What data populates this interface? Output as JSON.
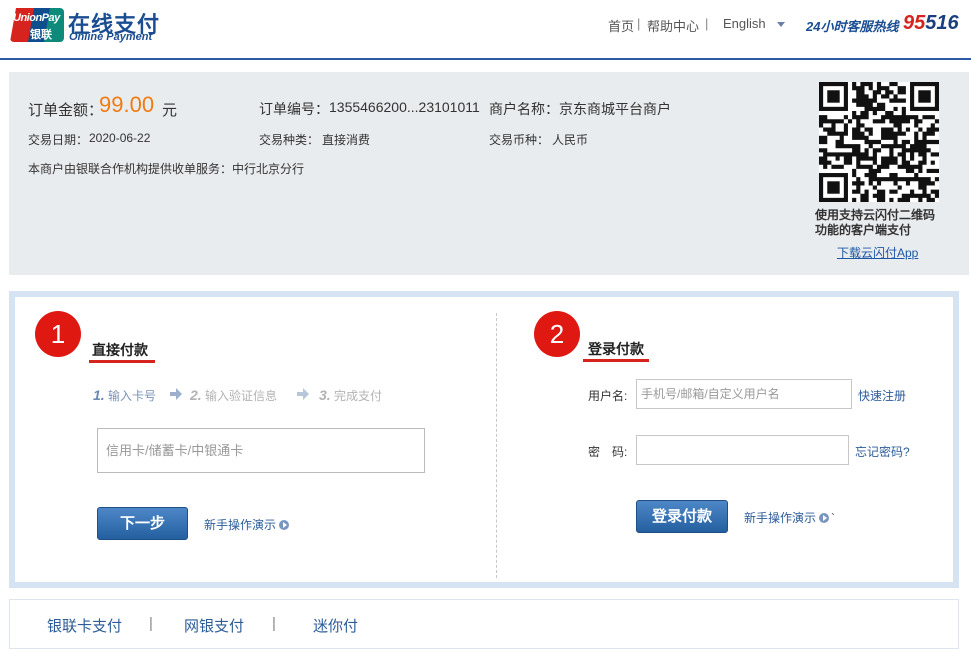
{
  "header": {
    "logo_top": "UnionPay",
    "logo_bottom": "银联",
    "brand_cn": "在线支付",
    "brand_en": "Online Payment",
    "nav_home": "首页",
    "nav_sep1": "|",
    "nav_help": "帮助中心",
    "nav_sep2": "|",
    "nav_lang": "English",
    "hotline_label": "24小时客服热线",
    "hotline_number_red": "95",
    "hotline_number_blue": "516"
  },
  "order": {
    "amount_label": "订单金额：",
    "amount_value": "99.00",
    "amount_unit": "元",
    "order_no_label": "订单编号：",
    "order_no_value": "1355466200...23101011",
    "merchant_label": "商户名称：",
    "merchant_value": "京东商城平台商户",
    "date_label": "交易日期：",
    "date_value": "2020-06-22",
    "type_label": "交易种类：",
    "type_value": "直接消费",
    "currency_label": "交易币种：",
    "currency_value": "人民币",
    "service_note": "本商户由银联合作机构提供收单服务：中行北京分行",
    "qr_caption": "使用支持云闪付二维码功能的客户端支付",
    "qr_download": "下载云闪付App"
  },
  "direct": {
    "badge": "1",
    "title": "直接付款",
    "step1_num": "1.",
    "step1_label": "输入卡号",
    "step2_num": "2.",
    "step2_label": "输入验证信息",
    "step3_num": "3.",
    "step3_label": "完成支付",
    "card_placeholder": "信用卡/储蓄卡/中银通卡",
    "next_button": "下一步",
    "demo_link": "新手操作演示"
  },
  "login": {
    "badge": "2",
    "title": "登录付款",
    "username_label": "用户名:",
    "username_placeholder": "手机号/邮箱/自定义用户名",
    "register_link": "快速注册",
    "password_label": "密　码:",
    "forgot_link": "忘记密码?",
    "login_button": "登录付款",
    "demo_link": "新手操作演示",
    "trailing_mark": "`"
  },
  "tabs": {
    "tab1": "银联卡支付",
    "sep": "|",
    "tab2": "网银支付",
    "tab3": "迷你付"
  },
  "colors": {
    "brand_blue": "#1b4d92",
    "unionpay_red": "#d7231e",
    "amount_orange": "#f07c11",
    "button_blue": "#245f9f"
  }
}
